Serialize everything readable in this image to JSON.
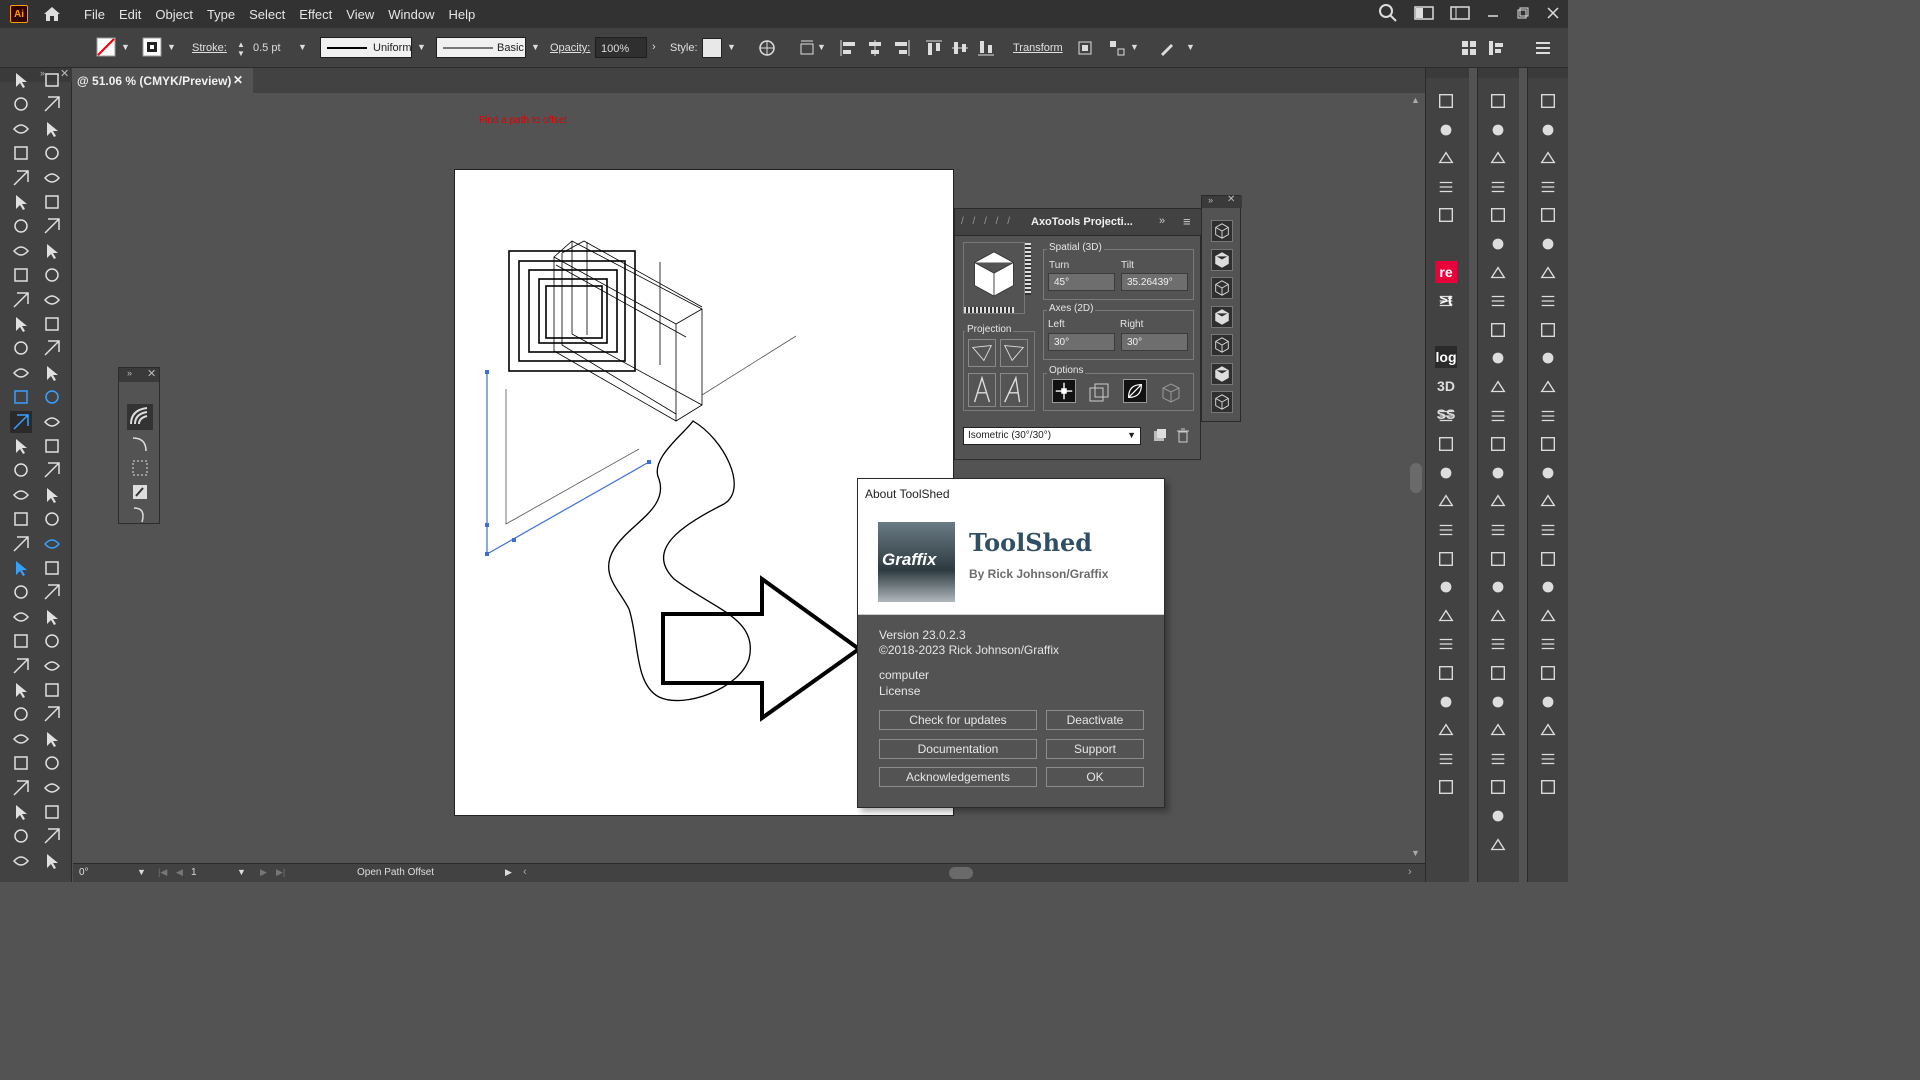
{
  "menubar": {
    "app_badge": "Ai",
    "items": [
      "File",
      "Edit",
      "Object",
      "Type",
      "Select",
      "Effect",
      "View",
      "Window",
      "Help"
    ]
  },
  "controlbar": {
    "stroke_label": "Stroke:",
    "stroke_value": "0.5 pt",
    "profile_uniform": "Uniform",
    "brush_basic": "Basic",
    "opacity_label": "Opacity:",
    "opacity_value": "100%",
    "style_label": "Style:",
    "transform_label": "Transform"
  },
  "document": {
    "tab_title": "@ 51.06 % (CMYK/Preview)",
    "hint_text": "Find a path to offset"
  },
  "axo_panel": {
    "title": "AxoTools Projecti...",
    "spatial_label": "Spatial (3D)",
    "turn_label": "Turn",
    "turn_value": "45°",
    "tilt_label": "Tilt",
    "tilt_value": "35.26439°",
    "axes_label": "Axes (2D)",
    "left_label": "Left",
    "left_value": "30°",
    "right_label": "Right",
    "right_value": "30°",
    "projection_label": "Projection",
    "options_label": "Options",
    "preset_value": "Isometric (30°/30°)"
  },
  "about_dialog": {
    "title": "About ToolShed",
    "brand": "ToolShed",
    "byline": "By Rick Johnson/Graffix",
    "logo_word": "Graffix",
    "version": "Version 23.0.2.3",
    "copyright": "©2018-2023 Rick Johnson/Graffix",
    "license_user": "computer",
    "license_label": "License",
    "buttons": {
      "check_updates": "Check for updates",
      "deactivate": "Deactivate",
      "documentation": "Documentation",
      "support": "Support",
      "acknowledgements": "Acknowledgements",
      "ok": "OK"
    }
  },
  "statusbar": {
    "rotation": "0°",
    "page": "1",
    "tool_name": "Open Path Offset"
  },
  "right_panel": {
    "re_badge": "re",
    "log_badge": "log",
    "threed_badge": "3D",
    "ss_badge": "SS",
    "xt_badge": ">t"
  },
  "colors": {
    "chrome_dark": "#323232",
    "panel": "#424242",
    "canvas": "#535353",
    "hint_red": "#e00000",
    "selection_blue": "#3b6fd6",
    "brand_blue": "#2f4f64",
    "re_red": "#e8003d"
  }
}
